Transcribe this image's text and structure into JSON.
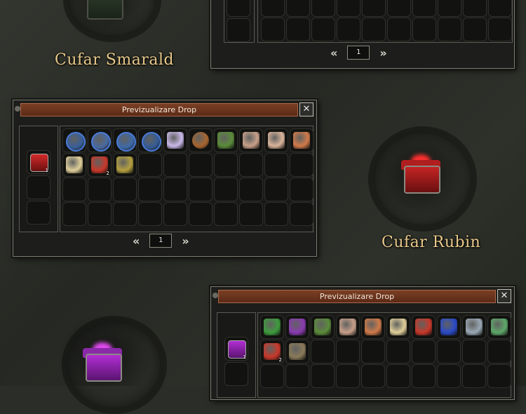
{
  "chests": {
    "smarald": {
      "label": "Cufar Smarald",
      "color": "#3da84a"
    },
    "rubin": {
      "label": "Cufar Rubin",
      "color": "#d12a2a"
    },
    "ametist": {
      "color": "#b02ad1"
    }
  },
  "windows": {
    "top": {
      "page": "1",
      "prev": "«",
      "next": "»"
    },
    "middle": {
      "title": "Previzualizare Drop",
      "close": "✕",
      "page": "1",
      "prev": "«",
      "next": "»",
      "side_count": "1",
      "items": [
        {
          "icon": "blue-ring-portrait-icon",
          "color": "#3a5f9a"
        },
        {
          "icon": "blue-ring-portrait-icon",
          "color": "#4a6aa0"
        },
        {
          "icon": "blue-ring-portrait-icon",
          "color": "#3f6aa8"
        },
        {
          "icon": "blue-ring-portrait-icon",
          "color": "#355c96"
        },
        {
          "icon": "crystal-burst-icon",
          "color": "#c9b8e8"
        },
        {
          "icon": "bronze-medallion-icon",
          "color": "#a8652f"
        },
        {
          "icon": "herb-icon",
          "color": "#5b8c3a"
        },
        {
          "icon": "sushi-icon",
          "color": "#c8a08a"
        },
        {
          "icon": "sushi-icon",
          "color": "#d9b49a"
        },
        {
          "icon": "sushi-icon",
          "color": "#d07a4a"
        },
        {
          "icon": "sushi-icon",
          "color": "#e0cf9a"
        },
        {
          "icon": "red-potion-icon",
          "color": "#c8382a",
          "count": "2"
        },
        {
          "icon": "golden-scroll-icon",
          "color": "#b5a040"
        }
      ]
    },
    "bottom": {
      "title": "Previzualizare Drop",
      "close": "✕",
      "side_count": "1",
      "items": [
        {
          "icon": "green-jar-icon",
          "color": "#3d9c3d"
        },
        {
          "icon": "purple-jar-icon",
          "color": "#8a3bb0"
        },
        {
          "icon": "herb-icon",
          "color": "#5b8c3a"
        },
        {
          "icon": "sushi-icon",
          "color": "#c8a08a"
        },
        {
          "icon": "sushi-icon",
          "color": "#d07a4a"
        },
        {
          "icon": "sushi-icon",
          "color": "#e0cf9a"
        },
        {
          "icon": "red-potion-icon",
          "color": "#c8382a"
        },
        {
          "icon": "blue-potion-icon",
          "color": "#2a4ac8"
        },
        {
          "icon": "sword-icon",
          "color": "#9aa8b5"
        },
        {
          "icon": "green-sword-icon",
          "color": "#5ea86a"
        },
        {
          "icon": "red-potion-icon",
          "color": "#c8382a",
          "count": "2"
        },
        {
          "icon": "arrows-icon",
          "color": "#8a7a5a"
        }
      ]
    }
  }
}
